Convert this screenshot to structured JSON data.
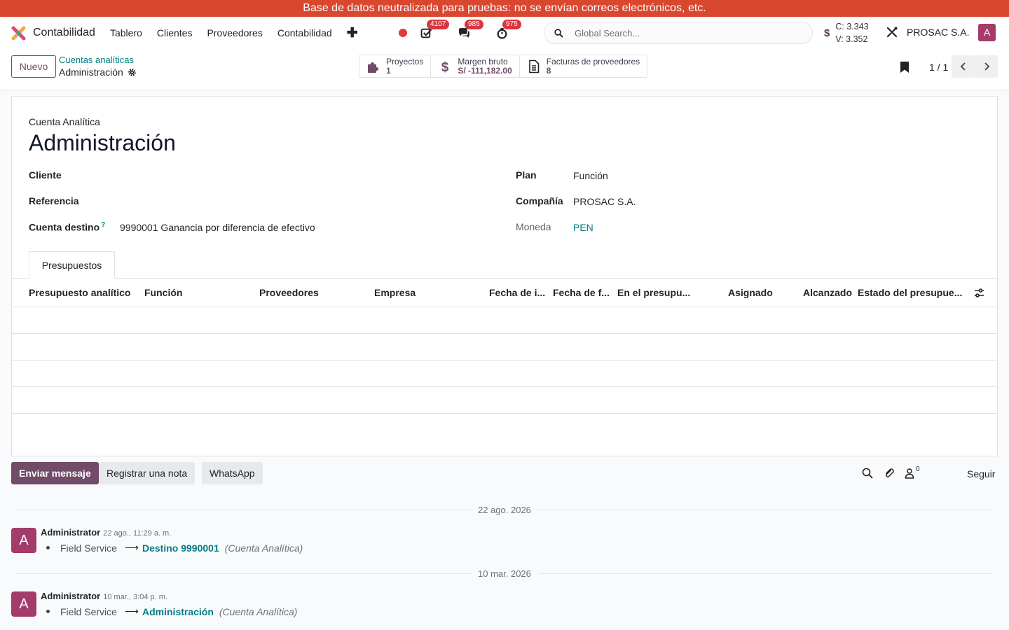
{
  "banner": "Base de datos neutralizada para pruebas: no se envían correos electrónicos, etc.",
  "navbar": {
    "app_name": "Contabilidad",
    "menu": [
      "Tablero",
      "Clientes",
      "Proveedores",
      "Contabilidad"
    ],
    "badges": {
      "activities": "4107",
      "messages": "985",
      "timesheets": "975"
    },
    "search_placeholder": "Global Search...",
    "counters": {
      "c": "C: 3.343",
      "v": "V: 3.352"
    },
    "company": "PROSAC S.A.",
    "avatar_letter": "A"
  },
  "control": {
    "new_label": "Nuevo",
    "breadcrumb_parent": "Cuentas analíticas",
    "breadcrumb_current": "Administración",
    "smart_buttons": [
      {
        "label": "Proyectos",
        "value": "1",
        "icon": "puzzle-icon"
      },
      {
        "label": "Margen bruto",
        "value": "S/ -111,182.00",
        "icon": "dollar-icon"
      },
      {
        "label": "Facturas de proveedores",
        "value": "8",
        "icon": "invoice-icon"
      }
    ],
    "pager": "1 / 1"
  },
  "form": {
    "kind_label": "Cuenta Analítica",
    "title": "Administración",
    "left_fields": [
      {
        "label": "Cliente",
        "value": ""
      },
      {
        "label": "Referencia",
        "value": ""
      },
      {
        "label": "Cuenta destino",
        "help": "?",
        "value": "9990001 Ganancia por diferencia de efectivo"
      }
    ],
    "right_fields": [
      {
        "label": "Plan",
        "value": "Función"
      },
      {
        "label": "Compañía",
        "value": "PROSAC S.A."
      },
      {
        "label": "Moneda",
        "value": "PEN"
      }
    ],
    "tab": "Presupuestos",
    "table_headers": [
      "Presupuesto analítico",
      "Función",
      "Proveedores",
      "Empresa",
      "Fecha de i...",
      "Fecha de f...",
      "En el presupu...",
      "Asignado",
      "Alcanzado",
      "Estado del presupue..."
    ]
  },
  "chatter": {
    "send_message": "Enviar mensaje",
    "log_note": "Registrar una nota",
    "whatsapp": "WhatsApp",
    "followers_count": "0",
    "follow": "Seguir",
    "messages": [
      {
        "date_separator": "22 ago. 2026",
        "author": "Administrator",
        "datetime": "22 ago., 11:29 a. m.",
        "field": "Field Service",
        "new_value": "Destino 9990001",
        "context": "(Cuenta Analítica)"
      },
      {
        "date_separator": "10 mar. 2026",
        "author": "Administrator",
        "datetime": "10 mar., 3:04 p. m.",
        "field": "Field Service",
        "new_value": "Administración",
        "context": "(Cuenta Analítica)"
      }
    ]
  },
  "colors": {
    "brand": "#714b67",
    "link": "#017e84",
    "banner": "#d9472f",
    "badge": "#d9363e",
    "avatar": "#a33b6b"
  }
}
